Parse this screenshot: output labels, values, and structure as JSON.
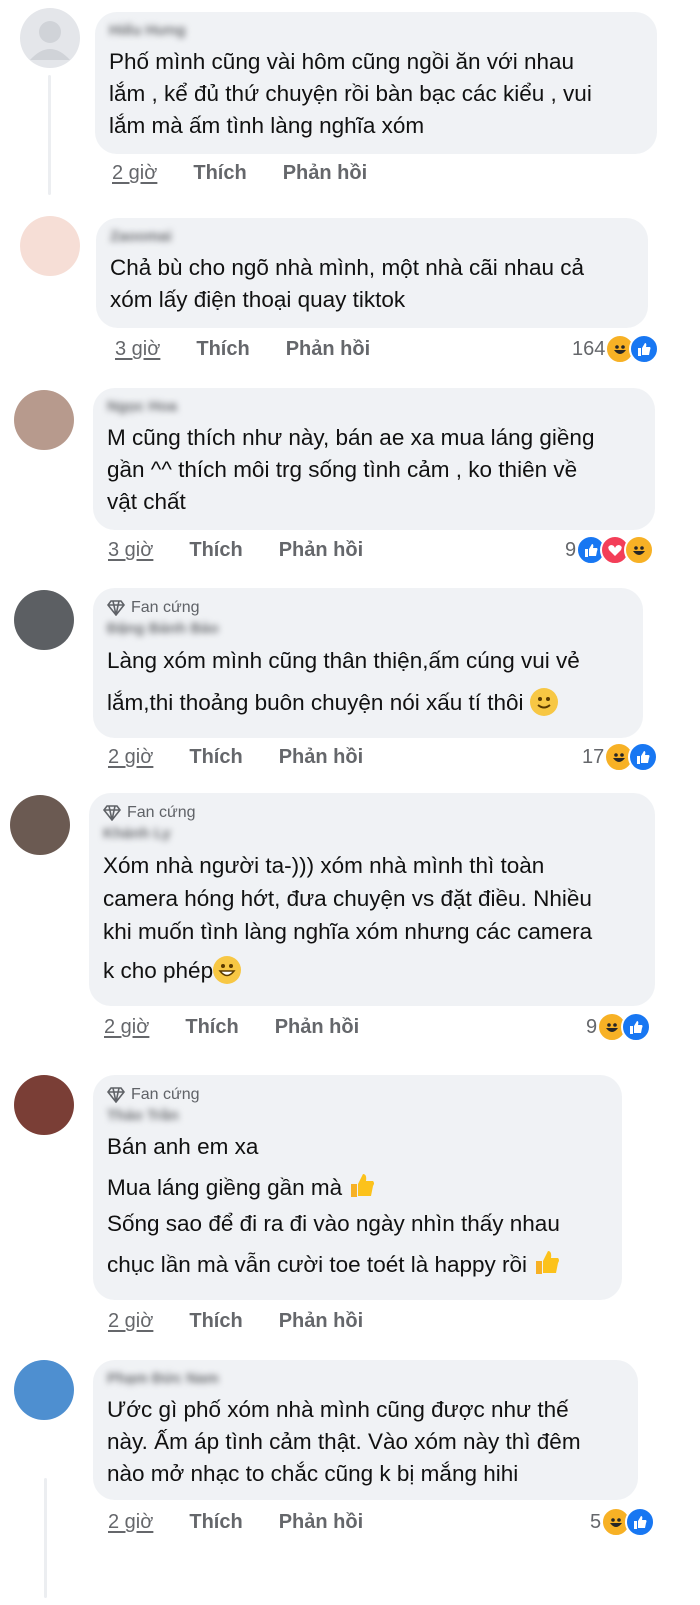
{
  "actions": {
    "like": "Thích",
    "reply": "Phản hồi"
  },
  "colors": {
    "like": "#1877f2",
    "haha": "#f7b125",
    "love": "#f33e58",
    "bubble": "#f0f2f5",
    "meta": "#65676b"
  },
  "comments": [
    {
      "author": "Hiếu Hưng",
      "badge": "",
      "lines": [
        "Phố mình cũng vài hôm cũng ngồi ăn với nhau",
        "lắm , kể đủ thứ chuyện rồi bàn bạc các kiểu , vui",
        "lắm mà ấm tình làng nghĩa xóm"
      ],
      "time": "2 giờ",
      "reaction_count": "",
      "reactions": []
    },
    {
      "author": "Zaoomai",
      "badge": "",
      "lines": [
        "Chả bù cho ngõ nhà mình, một nhà cãi nhau cả",
        "xóm lấy điện thoại quay tiktok"
      ],
      "time": "3 giờ",
      "reaction_count": "164",
      "reactions": [
        "haha-icon",
        "like-icon"
      ]
    },
    {
      "author": "Ngọc Hoa",
      "badge": "",
      "lines": [
        "M cũng thích như này, bán ae xa mua láng giềng",
        "gần ^^ thích môi trg sống tình cảm , ko thiên về",
        "vật chất"
      ],
      "time": "3 giờ",
      "reaction_count": "9",
      "reactions": [
        "like-icon",
        "love-icon",
        "haha-icon"
      ]
    },
    {
      "author": "Đặng Bảnh Bảo",
      "badge": "Fan cứng",
      "lines": [
        "Làng xóm mình cũng thân thiện,ấm cúng vui vẻ",
        "lắm,thi thoảng buôn chuyện nói xấu tí thôi"
      ],
      "time": "2 giờ",
      "reaction_count": "17",
      "reactions": [
        "haha-icon",
        "like-icon"
      ]
    },
    {
      "author": "Khánh Ly",
      "badge": "Fan cứng",
      "lines": [
        "Xóm nhà người ta-))) xóm nhà mình thì toàn",
        "camera hóng hớt, đưa chuyện vs đặt điều. Nhiều",
        "khi muốn tình làng nghĩa xóm nhưng các camera",
        "k cho phép"
      ],
      "time": "2 giờ",
      "reaction_count": "9",
      "reactions": [
        "haha-icon",
        "like-icon"
      ]
    },
    {
      "author": "Thảo Trần",
      "badge": "Fan cứng",
      "lines": [
        "Bán anh em xa",
        "Mua láng giềng gần mà",
        "Sống sao để đi ra đi vào ngày nhìn thấy nhau",
        "chục lần mà vẫn cười toe toét là happy rồi"
      ],
      "time": "2 giờ",
      "reaction_count": "",
      "reactions": []
    },
    {
      "author": "Phạm Đức Nam",
      "badge": "",
      "lines": [
        "Ước gì phố xóm nhà mình cũng được như thế",
        "này. Ấm áp tình cảm thật. Vào xóm này thì đêm",
        "nào mở nhạc to chắc cũng k bị mắng hihi"
      ],
      "time": "2 giờ",
      "reaction_count": "5",
      "reactions": [
        "haha-icon",
        "like-icon"
      ]
    }
  ]
}
